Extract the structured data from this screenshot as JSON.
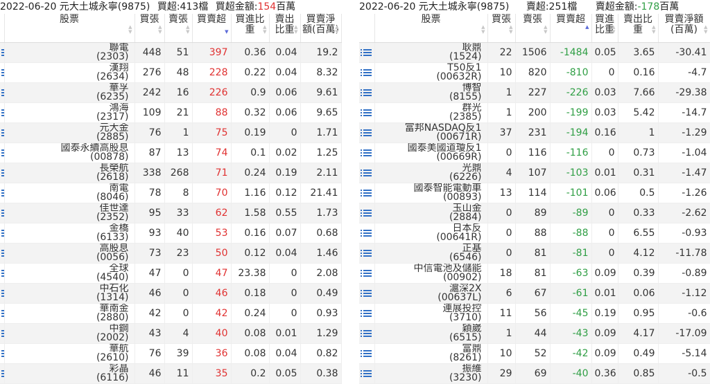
{
  "left": {
    "summary": {
      "title": "2022-06-20 元大土城永寧(9875)",
      "net_label": "買超:413檔",
      "amount_prefix": "買超金額:",
      "amount_value": "154",
      "amount_unit": "百萬"
    },
    "headers": {
      "stock": "股票",
      "buy": "買張",
      "sell": "賣張",
      "net": "買賣超",
      "buy_ratio": "買進比重",
      "sell_ratio": "賣出比重",
      "net_amount": "買賣淨額(百萬)"
    },
    "rows": [
      {
        "name": "聯電",
        "code": "(2303)",
        "buy": "448",
        "sell": "51",
        "net": "397",
        "buy_ratio": "0.36",
        "sell_ratio": "0.04",
        "amount": "19.2"
      },
      {
        "name": "漢翔",
        "code": "(2634)",
        "buy": "276",
        "sell": "48",
        "net": "228",
        "buy_ratio": "0.22",
        "sell_ratio": "0.04",
        "amount": "8.32"
      },
      {
        "name": "華孚",
        "code": "(6235)",
        "buy": "242",
        "sell": "16",
        "net": "226",
        "buy_ratio": "0.9",
        "sell_ratio": "0.06",
        "amount": "9.61"
      },
      {
        "name": "鴻海",
        "code": "(2317)",
        "buy": "109",
        "sell": "21",
        "net": "88",
        "buy_ratio": "0.32",
        "sell_ratio": "0.06",
        "amount": "9.65"
      },
      {
        "name": "元大金",
        "code": "(2885)",
        "buy": "76",
        "sell": "1",
        "net": "75",
        "buy_ratio": "0.19",
        "sell_ratio": "0",
        "amount": "1.71"
      },
      {
        "name": "國泰永續高股息",
        "code": "(00878)",
        "buy": "87",
        "sell": "13",
        "net": "74",
        "buy_ratio": "0.1",
        "sell_ratio": "0.02",
        "amount": "1.25"
      },
      {
        "name": "長榮航",
        "code": "(2618)",
        "buy": "338",
        "sell": "268",
        "net": "71",
        "buy_ratio": "0.24",
        "sell_ratio": "0.19",
        "amount": "2.11"
      },
      {
        "name": "南電",
        "code": "(8046)",
        "buy": "78",
        "sell": "8",
        "net": "70",
        "buy_ratio": "1.16",
        "sell_ratio": "0.12",
        "amount": "21.41"
      },
      {
        "name": "佳世達",
        "code": "(2352)",
        "buy": "95",
        "sell": "33",
        "net": "62",
        "buy_ratio": "1.58",
        "sell_ratio": "0.55",
        "amount": "1.73"
      },
      {
        "name": "金橋",
        "code": "(6133)",
        "buy": "93",
        "sell": "40",
        "net": "53",
        "buy_ratio": "0.16",
        "sell_ratio": "0.07",
        "amount": "0.68"
      },
      {
        "name": "高股息",
        "code": "(0056)",
        "buy": "73",
        "sell": "23",
        "net": "50",
        "buy_ratio": "0.12",
        "sell_ratio": "0.04",
        "amount": "1.46"
      },
      {
        "name": "全球",
        "code": "(4540)",
        "buy": "47",
        "sell": "0",
        "net": "47",
        "buy_ratio": "23.38",
        "sell_ratio": "0",
        "amount": "2.08"
      },
      {
        "name": "中石化",
        "code": "(1314)",
        "buy": "46",
        "sell": "0",
        "net": "46",
        "buy_ratio": "0.18",
        "sell_ratio": "0",
        "amount": "0.49"
      },
      {
        "name": "華南金",
        "code": "(2880)",
        "buy": "42",
        "sell": "0",
        "net": "42",
        "buy_ratio": "0.24",
        "sell_ratio": "0",
        "amount": "0.93"
      },
      {
        "name": "中鋼",
        "code": "(2002)",
        "buy": "43",
        "sell": "4",
        "net": "40",
        "buy_ratio": "0.08",
        "sell_ratio": "0.01",
        "amount": "1.29"
      },
      {
        "name": "華航",
        "code": "(2610)",
        "buy": "76",
        "sell": "39",
        "net": "36",
        "buy_ratio": "0.08",
        "sell_ratio": "0.04",
        "amount": "0.82"
      },
      {
        "name": "彩晶",
        "code": "(6116)",
        "buy": "46",
        "sell": "11",
        "net": "35",
        "buy_ratio": "0.2",
        "sell_ratio": "0.05",
        "amount": "0.38"
      }
    ]
  },
  "right": {
    "summary": {
      "title": "2022-06-20 元大土城永寧(9875)",
      "net_label": "賣超:251檔",
      "amount_prefix": "賣超金額:",
      "amount_value": "-178",
      "amount_unit": "百萬"
    },
    "headers": {
      "stock": "股票",
      "buy": "買張",
      "sell": "賣張",
      "net": "買賣超",
      "buy_ratio": "買進比重",
      "sell_ratio": "賣出比重",
      "net_amount": "買賣淨額(百萬)"
    },
    "rows": [
      {
        "name": "耿鼎",
        "code": "(1524)",
        "buy": "22",
        "sell": "1506",
        "net": "-1484",
        "buy_ratio": "0.05",
        "sell_ratio": "3.65",
        "amount": "-30.41"
      },
      {
        "name": "T50反1",
        "code": "(00632R)",
        "buy": "10",
        "sell": "820",
        "net": "-810",
        "buy_ratio": "0",
        "sell_ratio": "0.16",
        "amount": "-4.7"
      },
      {
        "name": "博智",
        "code": "(8155)",
        "buy": "1",
        "sell": "227",
        "net": "-226",
        "buy_ratio": "0.03",
        "sell_ratio": "7.66",
        "amount": "-29.38"
      },
      {
        "name": "群光",
        "code": "(2385)",
        "buy": "1",
        "sell": "200",
        "net": "-199",
        "buy_ratio": "0.03",
        "sell_ratio": "5.42",
        "amount": "-14.7"
      },
      {
        "name": "富邦NASDAQ反1",
        "code": "(00671R)",
        "buy": "37",
        "sell": "231",
        "net": "-194",
        "buy_ratio": "0.16",
        "sell_ratio": "1",
        "amount": "-1.29"
      },
      {
        "name": "國泰美國道瓊反1",
        "code": "(00669R)",
        "buy": "0",
        "sell": "116",
        "net": "-116",
        "buy_ratio": "0",
        "sell_ratio": "0.73",
        "amount": "-1.04"
      },
      {
        "name": "光鼎",
        "code": "(6226)",
        "buy": "4",
        "sell": "107",
        "net": "-103",
        "buy_ratio": "0.01",
        "sell_ratio": "0.31",
        "amount": "-1.47"
      },
      {
        "name": "國泰智能電動車",
        "code": "(00893)",
        "buy": "13",
        "sell": "114",
        "net": "-101",
        "buy_ratio": "0.06",
        "sell_ratio": "0.5",
        "amount": "-1.26"
      },
      {
        "name": "玉山金",
        "code": "(2884)",
        "buy": "0",
        "sell": "89",
        "net": "-89",
        "buy_ratio": "0",
        "sell_ratio": "0.33",
        "amount": "-2.62"
      },
      {
        "name": "日本反",
        "code": "(00641R)",
        "buy": "0",
        "sell": "88",
        "net": "-88",
        "buy_ratio": "0",
        "sell_ratio": "6.55",
        "amount": "-0.93"
      },
      {
        "name": "正基",
        "code": "(6546)",
        "buy": "0",
        "sell": "81",
        "net": "-81",
        "buy_ratio": "0",
        "sell_ratio": "4.12",
        "amount": "-11.78"
      },
      {
        "name": "中信電池及儲能",
        "code": "(00902)",
        "buy": "18",
        "sell": "81",
        "net": "-63",
        "buy_ratio": "0.09",
        "sell_ratio": "0.39",
        "amount": "-0.89"
      },
      {
        "name": "滬深2X",
        "code": "(00637L)",
        "buy": "6",
        "sell": "67",
        "net": "-61",
        "buy_ratio": "0.01",
        "sell_ratio": "0.06",
        "amount": "-1.12"
      },
      {
        "name": "連展投控",
        "code": "(3710)",
        "buy": "11",
        "sell": "56",
        "net": "-45",
        "buy_ratio": "0.19",
        "sell_ratio": "0.95",
        "amount": "-0.6"
      },
      {
        "name": "穎崴",
        "code": "(6515)",
        "buy": "1",
        "sell": "44",
        "net": "-43",
        "buy_ratio": "0.09",
        "sell_ratio": "4.17",
        "amount": "-17.09"
      },
      {
        "name": "富鼎",
        "code": "(8261)",
        "buy": "10",
        "sell": "52",
        "net": "-42",
        "buy_ratio": "0.09",
        "sell_ratio": "0.49",
        "amount": "-5.14"
      },
      {
        "name": "振維",
        "code": "(3230)",
        "buy": "29",
        "sell": "69",
        "net": "-40",
        "buy_ratio": "0.36",
        "sell_ratio": "0.85",
        "amount": "-0.5"
      }
    ]
  },
  "colors": {
    "positive": "#e03131",
    "negative": "#2f9e44",
    "menu_icon": "#2f6fc5",
    "sort_active": "#5b6ad8"
  },
  "icons": {
    "row_menu": "list-menu-icon",
    "sort": "sort-arrows-icon"
  }
}
